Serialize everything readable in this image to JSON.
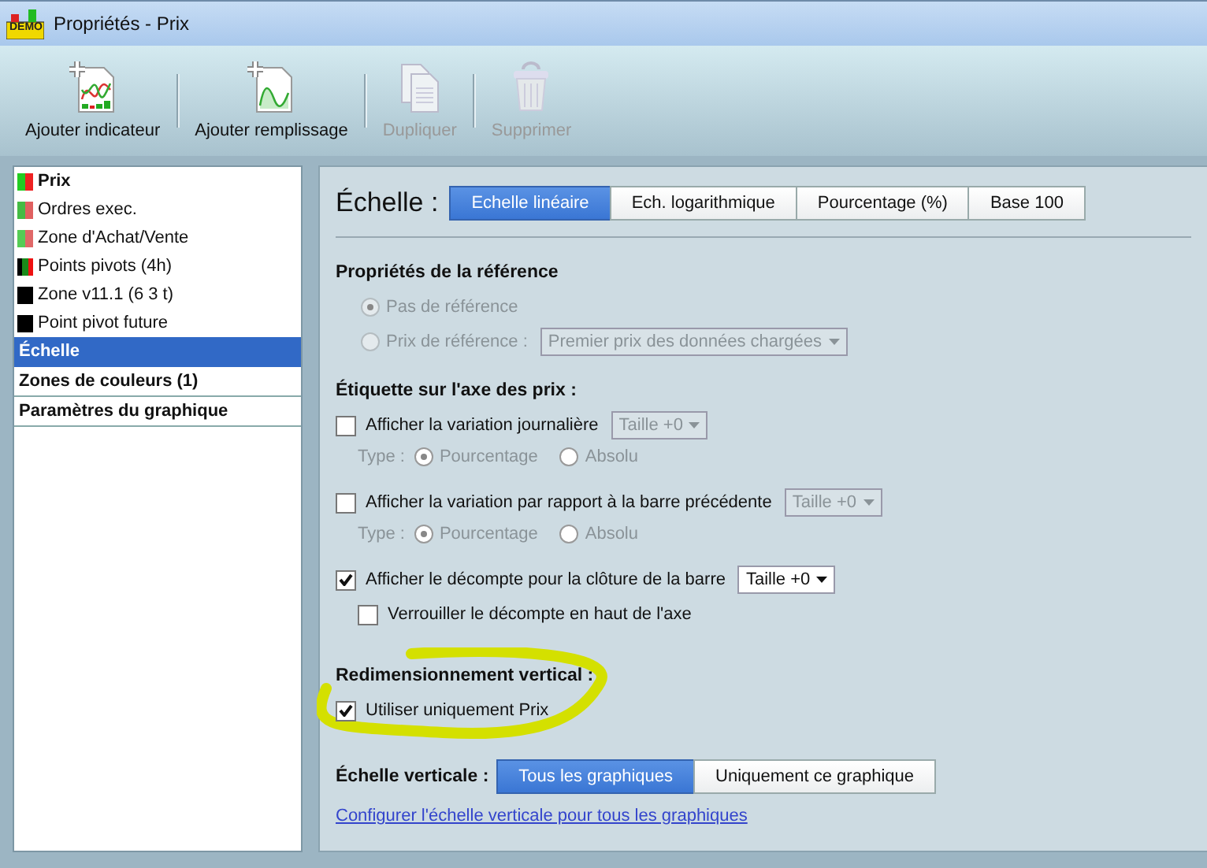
{
  "window": {
    "title": "Propriétés - Prix",
    "logo": "DEMO"
  },
  "toolbar": [
    {
      "label": "Ajouter indicateur",
      "kind": "indicator",
      "disabled": false
    },
    {
      "label": "Ajouter remplissage",
      "kind": "fill",
      "disabled": false
    },
    {
      "label": "Dupliquer",
      "kind": "copy",
      "disabled": true
    },
    {
      "label": "Supprimer",
      "kind": "trash",
      "disabled": true
    }
  ],
  "sidebar": {
    "items": [
      {
        "label": "Prix",
        "kind": "main",
        "swatch": [
          {
            "color": "#22cc22"
          },
          {
            "color": "#ee2222"
          }
        ],
        "selected": false
      },
      {
        "label": "Ordres exec.",
        "kind": "indicator",
        "swatch": [
          {
            "color": "#44bb44"
          },
          {
            "color": "#e06060"
          }
        ],
        "selected": false
      },
      {
        "label": "Zone d'Achat/Vente",
        "kind": "indicator",
        "swatch": [
          {
            "color": "#55cc55"
          },
          {
            "color": "#e06868"
          }
        ],
        "selected": false
      },
      {
        "label": "Points pivots (4h)",
        "kind": "indicator",
        "swatch": [
          {
            "color": "#000000"
          },
          {
            "color": "#1a8a1a"
          },
          {
            "color": "#ee1111"
          }
        ],
        "selected": false
      },
      {
        "label": "Zone v11.1 (6 3 t)",
        "kind": "indicator",
        "swatch": [
          {
            "color": "#000000"
          }
        ],
        "selected": false
      },
      {
        "label": "Point pivot future",
        "kind": "indicator",
        "swatch": [
          {
            "color": "#000000"
          }
        ],
        "selected": false
      },
      {
        "label": "Échelle",
        "kind": "section",
        "selected": true
      },
      {
        "label": "Zones de couleurs (1)",
        "kind": "section",
        "selected": false
      },
      {
        "label": "Paramètres du graphique",
        "kind": "section",
        "selected": false
      }
    ]
  },
  "scale": {
    "label": "Échelle :",
    "options": [
      {
        "label": "Echelle linéaire",
        "selected": true
      },
      {
        "label": "Ech. logarithmique",
        "selected": false
      },
      {
        "label": "Pourcentage (%)",
        "selected": false
      },
      {
        "label": "Base 100",
        "selected": false
      }
    ]
  },
  "reference": {
    "heading": "Propriétés de la référence",
    "options": [
      {
        "label": "Pas de référence",
        "selected": true,
        "disabled": true
      },
      {
        "label": "Prix de référence :",
        "selected": false,
        "disabled": true,
        "dropdown": "Premier prix des données chargées"
      }
    ]
  },
  "axis_label": {
    "heading": "Étiquette sur l'axe des prix :",
    "items": [
      {
        "label": "Afficher la variation journalière",
        "checked": false,
        "size": "Taille +0",
        "type_label": "Type :",
        "types": [
          {
            "label": "Pourcentage",
            "selected": true
          },
          {
            "label": "Absolu",
            "selected": false
          }
        ]
      },
      {
        "label": "Afficher la variation par rapport à la barre précédente",
        "checked": false,
        "size": "Taille +0",
        "type_label": "Type :",
        "types": [
          {
            "label": "Pourcentage",
            "selected": true
          },
          {
            "label": "Absolu",
            "selected": false
          }
        ]
      },
      {
        "label": "Afficher le décompte pour la clôture de la barre",
        "checked": true,
        "size": "Taille +0",
        "sub": {
          "label": "Verrouiller le décompte en haut de l'axe",
          "checked": false
        }
      }
    ]
  },
  "vertical_resize": {
    "heading": "Redimensionnement vertical :",
    "option": {
      "label": "Utiliser uniquement Prix",
      "checked": true
    },
    "highlighted": true
  },
  "vertical_scale": {
    "label": "Échelle verticale :",
    "options": [
      {
        "label": "Tous les graphiques",
        "selected": true
      },
      {
        "label": "Uniquement ce graphique",
        "selected": false
      }
    ],
    "link": "Configurer l'échelle verticale pour tous les graphiques"
  }
}
